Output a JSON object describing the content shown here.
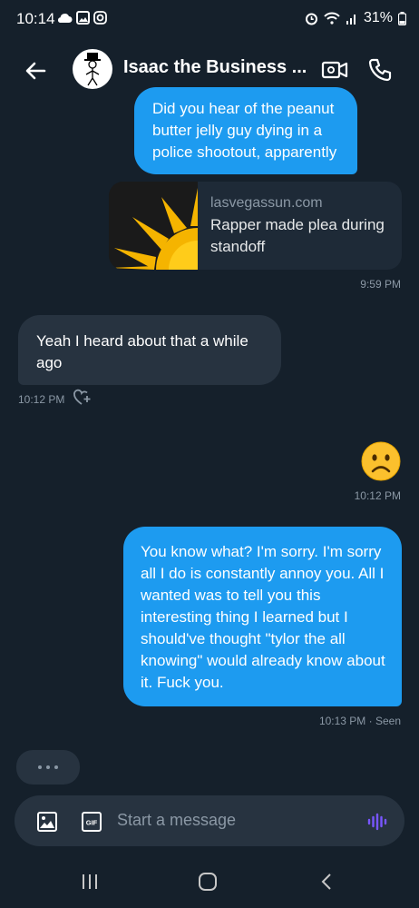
{
  "status_bar": {
    "time": "10:14",
    "battery": "31%"
  },
  "header": {
    "contact_name": "Isaac the Business ..."
  },
  "messages": [
    {
      "direction": "outgoing",
      "text": "Did you hear of the peanut butter jelly guy dying in a police shootout, apparently"
    },
    {
      "direction": "outgoing",
      "type": "link-card",
      "domain": "lasvegassun.com",
      "headline": "Rapper made plea during standoff",
      "time": "9:59 PM"
    },
    {
      "direction": "incoming",
      "text": "Yeah I heard about that a while ago",
      "time": "10:12 PM"
    },
    {
      "direction": "outgoing",
      "emoji": "☹️",
      "time": "10:12 PM"
    },
    {
      "direction": "outgoing",
      "text": "You know what? I'm sorry. I'm sorry all I do is constantly annoy you. All I wanted was to tell you this interesting thing I learned but I should've thought \"tylor the all knowing\" would already know about it. Fuck you.",
      "time": "10:13 PM · Seen"
    }
  ],
  "composer": {
    "placeholder": "Start a message"
  },
  "colors": {
    "background": "#15202b",
    "accent": "#1d9bf0",
    "incoming_bubble": "#273340",
    "secondary_text": "#8b98a5"
  }
}
